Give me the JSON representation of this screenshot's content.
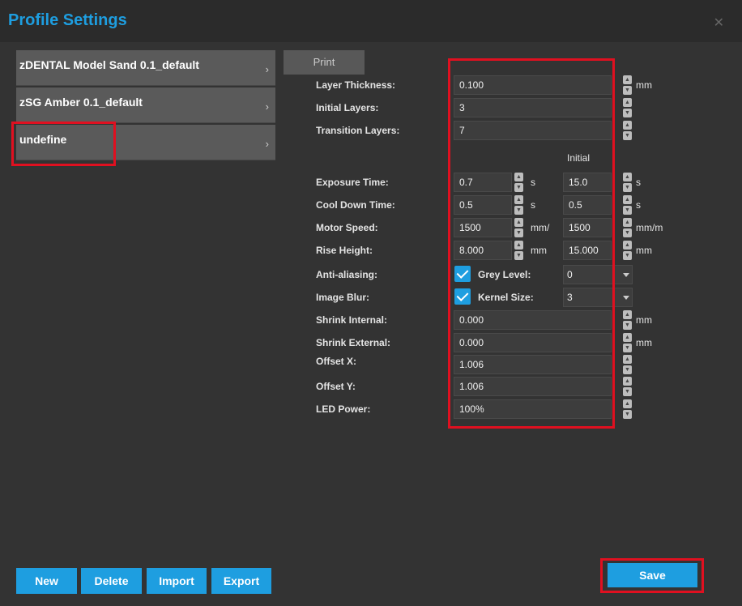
{
  "window": {
    "title": "Profile Settings",
    "close_glyph": "✕"
  },
  "profiles": [
    {
      "label": "zDENTAL Model Sand 0.1_default"
    },
    {
      "label": "zSG Amber 0.1_default"
    },
    {
      "label": "undefine"
    }
  ],
  "chevron": "›",
  "tab": {
    "label": "Print"
  },
  "column_header": "Initial",
  "fields": {
    "layer_thickness": {
      "label": "Layer Thickness:",
      "value": "0.100",
      "unit": "mm"
    },
    "initial_layers": {
      "label": "Initial Layers:",
      "value": "3"
    },
    "transition_layers": {
      "label": "Transition Layers:",
      "value": "7"
    },
    "exposure_time": {
      "label": "Exposure Time:",
      "value": "0.7",
      "unit": "s",
      "initial": "15.0",
      "initial_unit": "s"
    },
    "cool_down_time": {
      "label": "Cool Down Time:",
      "value": "0.5",
      "unit": "s",
      "initial": "0.5",
      "initial_unit": "s"
    },
    "motor_speed": {
      "label": "Motor Speed:",
      "value": "1500",
      "unit": "mm/",
      "initial": "1500",
      "initial_unit": "mm/m"
    },
    "rise_height": {
      "label": "Rise Height:",
      "value": "8.000",
      "unit": "mm",
      "initial": "15.000",
      "initial_unit": "mm"
    },
    "anti_aliasing": {
      "label": "Anti-aliasing:",
      "sub_label": "Grey Level:",
      "select_value": "0"
    },
    "image_blur": {
      "label": "Image Blur:",
      "sub_label": "Kernel Size:",
      "select_value": "3"
    },
    "shrink_internal": {
      "label": "Shrink Internal:",
      "value": "0.000",
      "unit": "mm"
    },
    "shrink_external": {
      "label": "Shrink External:",
      "value": "0.000",
      "unit": "mm"
    },
    "offset_x": {
      "label": "Offset X:",
      "value": "1.006"
    },
    "offset_y": {
      "label": "Offset Y:",
      "value": "1.006"
    },
    "led_power": {
      "label": "LED Power:",
      "value": "100%"
    }
  },
  "buttons": {
    "new": "New",
    "delete": "Delete",
    "import": "Import",
    "export": "Export",
    "save": "Save"
  },
  "colors": {
    "accent": "#1e9ee0",
    "highlight": "#e01020",
    "background": "#333333"
  }
}
